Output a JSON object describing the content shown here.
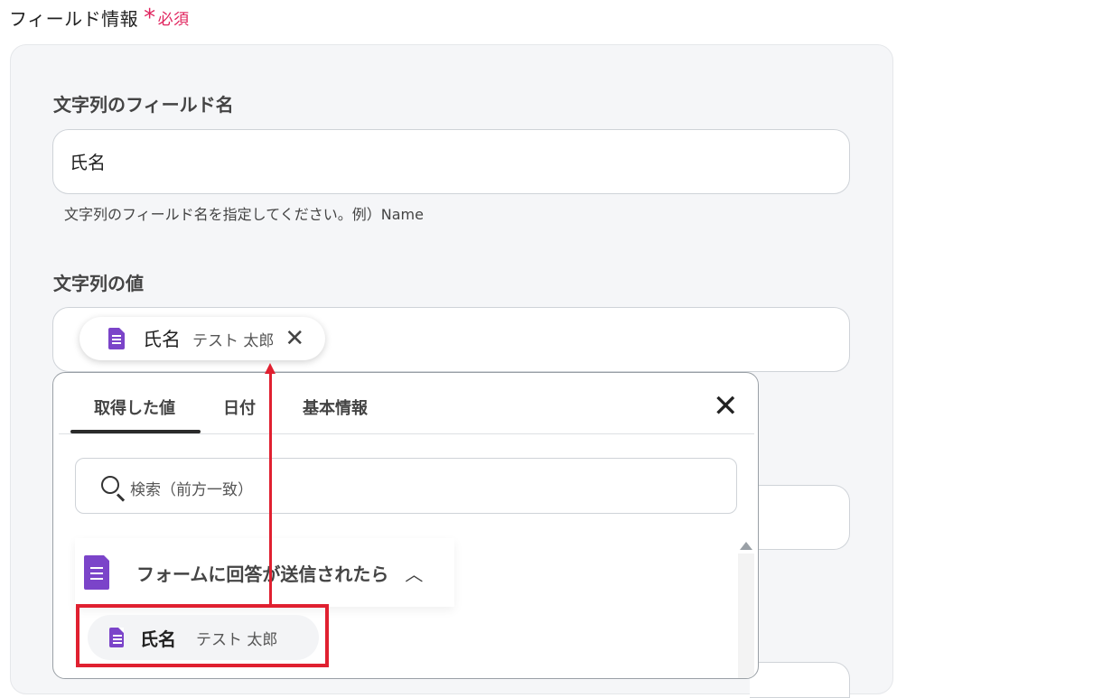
{
  "section": {
    "title": "フィールド情報",
    "required_star": "*",
    "required_label": "必須"
  },
  "field_name": {
    "label": "文字列のフィールド名",
    "value": "氏名",
    "help": "文字列のフィールド名を指定してください。例）Name"
  },
  "field_value": {
    "label": "文字列の値",
    "chip": {
      "icon": "google-forms-icon",
      "name": "氏名",
      "sample": "テスト 太郎",
      "remove": "✕"
    }
  },
  "dropdown": {
    "tabs": [
      {
        "label": "取得した値",
        "active": true
      },
      {
        "label": "日付",
        "active": false
      },
      {
        "label": "基本情報",
        "active": false
      }
    ],
    "close": "✕",
    "search_placeholder": "検索（前方一致）",
    "group": {
      "icon": "google-forms-icon",
      "title": "フォームに回答が送信されたら",
      "expanded": true,
      "items": [
        {
          "icon": "google-forms-icon",
          "name": "氏名",
          "sample": "テスト 太郎"
        }
      ]
    }
  },
  "colors": {
    "required": "#e0245e",
    "forms_purple": "#7b44c9",
    "annotation_red": "#e02030",
    "panel_bg": "#f5f6f8"
  }
}
